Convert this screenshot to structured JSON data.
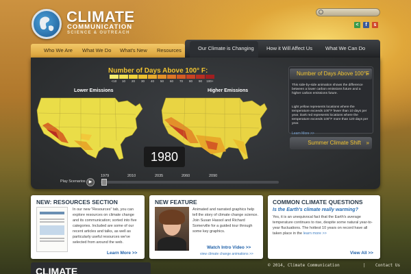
{
  "logo": {
    "title": "CLIMATE",
    "subtitle": "COMMUNICATION",
    "tagline": "SCIENCE & OUTREACH"
  },
  "search": {
    "placeholder": ""
  },
  "social": [
    "share-icon",
    "facebook-icon",
    "stumbleupon-icon"
  ],
  "nav": {
    "left": [
      "Who We Are",
      "What We Do",
      "What's New",
      "Resources"
    ],
    "right": [
      "Our Climate is Changing",
      "How it Will Affect Us",
      "What We Can Do"
    ]
  },
  "main": {
    "title": "Number of Days Above 100° F:",
    "legend": [
      "<10",
      "10",
      "20",
      "30",
      "40",
      "50",
      "60",
      "70",
      "80",
      "90",
      "100+"
    ],
    "legend_colors": [
      "#f5ec6e",
      "#f2e051",
      "#efd23a",
      "#ebbf2e",
      "#e8a92a",
      "#e38f28",
      "#dd7526",
      "#d45b24",
      "#c94223",
      "#b82e22",
      "#a11e20"
    ],
    "map_left_label": "Lower Emissions",
    "map_right_label": "Higher Emissions",
    "year": "1980",
    "play_label": "Play Scenarios",
    "timeline_years": [
      "1979",
      "2010",
      "2035",
      "2060",
      "2090"
    ]
  },
  "info": {
    "header": "Number of Days Above 100°F",
    "para1": "This side-by-side animation shows the difference between a lower carbon emissions future and a higher carbon emissions future.",
    "para2": "Light yellow represents locations where the temperature exceeds 100°F fewer than 10 days per year. Dark red represents locations where the temperature exceeds 100°F more than 120 days per year.",
    "link": "Learn More >>",
    "section2": "Summer Climate Shift"
  },
  "cards": {
    "resources": {
      "title": "NEW: RESOURCES SECTION",
      "text": "In our new \"Resources\" tab, you can explore resources on climate change and its communication; sorted into five categories. Included are some of our recent articles and talks, as well as particularly useful resources we've selected from around the web.",
      "link": "Learn More >>"
    },
    "feature": {
      "title": "NEW FEATURE",
      "text": "Animated and narrated graphics help tell the story of climate change science. Join Susan Hassol and Richard Somerville for a guided tour through some key graphics.",
      "link": "Watch Intro Video >>",
      "link2": "view climate change animations >>"
    },
    "questions": {
      "title": "COMMON CLIMATE QUESTIONS",
      "question": "Is the Earth's climate really warming?",
      "text": "Yes, it is an unequivocal fact that the Earth's average temperature continues to rise, despite some natural year-to-year fluctuations. The hottest 10 years on record have all taken place in the",
      "more": "learn more >>",
      "link": "View All >>"
    }
  },
  "footer": {
    "logo": "CLIMATE",
    "copyright": "© 2014, Climate Communication",
    "separator": "|",
    "contact": "Contact Us"
  }
}
